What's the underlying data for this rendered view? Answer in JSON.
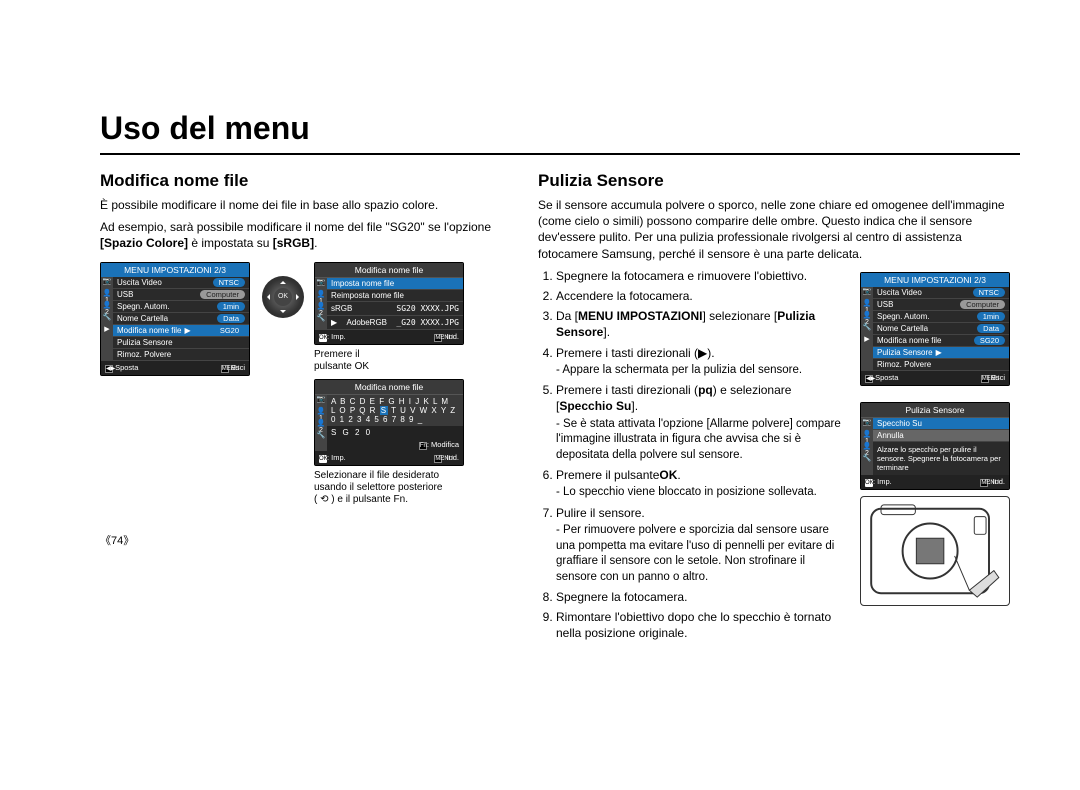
{
  "page": {
    "title": "Uso del menu",
    "number": "《74》"
  },
  "left": {
    "heading": "Modifica nome file",
    "para1": "È possibile modificare il nome dei file in base allo spazio colore.",
    "para2_a": "Ad esempio, sarà possibile modificare il nome del file \"SG20\" se l'opzione ",
    "para2_b": "[Spazio Colore]",
    "para2_c": " è impostata su ",
    "para2_d": "[sRGB]",
    "para2_e": ".",
    "caption1a": "Premere il",
    "caption1b": "pulsante OK",
    "caption2a": "Selezionare il file desiderato",
    "caption2b": "usando il selettore posteriore",
    "caption2c": "( ⟲ ) e il pulsante Fn.",
    "screen1": {
      "title": "MENU IMPOSTAZIONI  2/3",
      "rows": [
        {
          "label": "Uscita Video",
          "val": "NTSC",
          "valClass": "val"
        },
        {
          "label": "USB",
          "val": "Computer",
          "valClass": "val-gray"
        },
        {
          "label": "Spegn. Autom.",
          "val": "1min",
          "valClass": "val"
        },
        {
          "label": "Nome Cartella",
          "val": "Data",
          "valClass": "val"
        },
        {
          "label": "Modifica nome file",
          "val": "SG20",
          "hl": true,
          "arrow": true
        },
        {
          "label": "Pulizia Sensore",
          "val": ""
        },
        {
          "label": "Rimoz. Polvere",
          "val": ""
        }
      ],
      "footL": " Sposta",
      "footR": " Esci",
      "footIconL": "◀▶",
      "footIconR": "MENU"
    },
    "screen2": {
      "title": "Modifica nome file",
      "row1": "Imposta nome file",
      "row2": "Reimposta nome file",
      "row3a": "sRGB",
      "row3b": "SG20 XXXX.JPG",
      "row4a": "AdobeRGB",
      "row4b": "_G20 XXXX.JPG",
      "footL": ": Imp.",
      "footR": ": Ind.",
      "footIconL": "OK",
      "footIconR": "MENU"
    },
    "screen3": {
      "title": "Modifica nome file",
      "grid_r1": "A B C D E F G H I J K L M",
      "grid_r2a": "L O P Q R ",
      "grid_r2hl": "S",
      "grid_r2b": " T U V W X Y Z",
      "grid_r3": "0 1 2 3 4 5 6 7 8 9 _",
      "grid_result": "S G 2 0",
      "modifica": ": Modifica",
      "fnIcon": "Fn",
      "footL": ": Imp.",
      "footR": ": Ind.",
      "footIconL": "OK",
      "footIconR": "MENU"
    }
  },
  "right": {
    "heading": "Pulizia Sensore",
    "para": "Se il sensore accumula polvere o sporco, nelle zone chiare ed omogenee dell'immagine (come cielo o simili) possono comparire delle ombre. Questo indica che il sensore dev'essere pulito. Per una pulizia professionale rivolgersi al centro di assistenza fotocamere Samsung, perché il sensore è una parte delicata.",
    "steps": [
      {
        "n": "1.",
        "t": "Spegnere la fotocamera e rimuovere l'obiettivo."
      },
      {
        "n": "2.",
        "t": "Accendere la fotocamera."
      },
      {
        "n": "3.",
        "ta": "Da  [",
        "tb": "MENU IMPOSTAZIONI",
        "tc": "] selezionare [",
        "td": "Pulizia Sensore",
        "te": "]."
      },
      {
        "n": "4.",
        "t": "Premere i tasti direzionali (▶).",
        "sub": [
          "Appare la schermata per la pulizia del sensore."
        ]
      },
      {
        "n": "5.",
        "ta": "Premere i tasti direzionali (",
        "tb": "pq",
        "tc": ") e selezionare [",
        "td": "Specchio Su",
        "te": "].",
        "sub": [
          "Se è stata attivata l'opzione [Allarme polvere] compare l'immagine illustrata in figura che avvisa che si è depositata della polvere sul sensore."
        ]
      },
      {
        "n": "6.",
        "ta": "Premere il pulsante",
        "tb": "OK",
        "tc": ".",
        "sub": [
          "Lo specchio viene bloccato in posizione sollevata."
        ]
      },
      {
        "n": "7.",
        "t": "Pulire il sensore.",
        "sub": [
          "Per rimuovere polvere e sporcizia dal sensore usare una pompetta ma evitare l'uso di pennelli per evitare di graffiare il sensore con le setole. Non strofinare il sensore con un panno o altro."
        ]
      },
      {
        "n": "8.",
        "t": "Spegnere la fotocamera."
      },
      {
        "n": "9.",
        "t": "Rimontare l'obiettivo dopo che lo specchio è tornato nella posizione originale."
      }
    ],
    "screenA": {
      "title": "MENU IMPOSTAZIONI  2/3",
      "rows": [
        {
          "label": "Uscita Video",
          "val": "NTSC",
          "valClass": "val"
        },
        {
          "label": "USB",
          "val": "Computer",
          "valClass": "val-gray"
        },
        {
          "label": "Spegn. Autom.",
          "val": "1min",
          "valClass": "val"
        },
        {
          "label": "Nome Cartella",
          "val": "Data",
          "valClass": "val"
        },
        {
          "label": "Modifica nome file",
          "val": "SG20",
          "valClass": "val"
        },
        {
          "label": "Pulizia Sensore",
          "val": "",
          "hl": true,
          "arrow": true
        },
        {
          "label": "Rimoz. Polvere",
          "val": ""
        }
      ],
      "footL": " Sposta",
      "footR": " Esci",
      "footIconL": "◀▶",
      "footIconR": "MENU"
    },
    "screenB": {
      "title": "Pulizia Sensore",
      "row1": "Specchio Su",
      "row2": "Annulla",
      "note": "Alzare lo specchio per pulire il sensore. Spegnere la fotocamera per terminare",
      "footL": ": Imp.",
      "footR": ": Ind.",
      "footIconL": "OK",
      "footIconR": "MENU"
    },
    "sideIcons": [
      "📷",
      "👤1",
      "👤2",
      "🔧",
      "▶"
    ]
  }
}
